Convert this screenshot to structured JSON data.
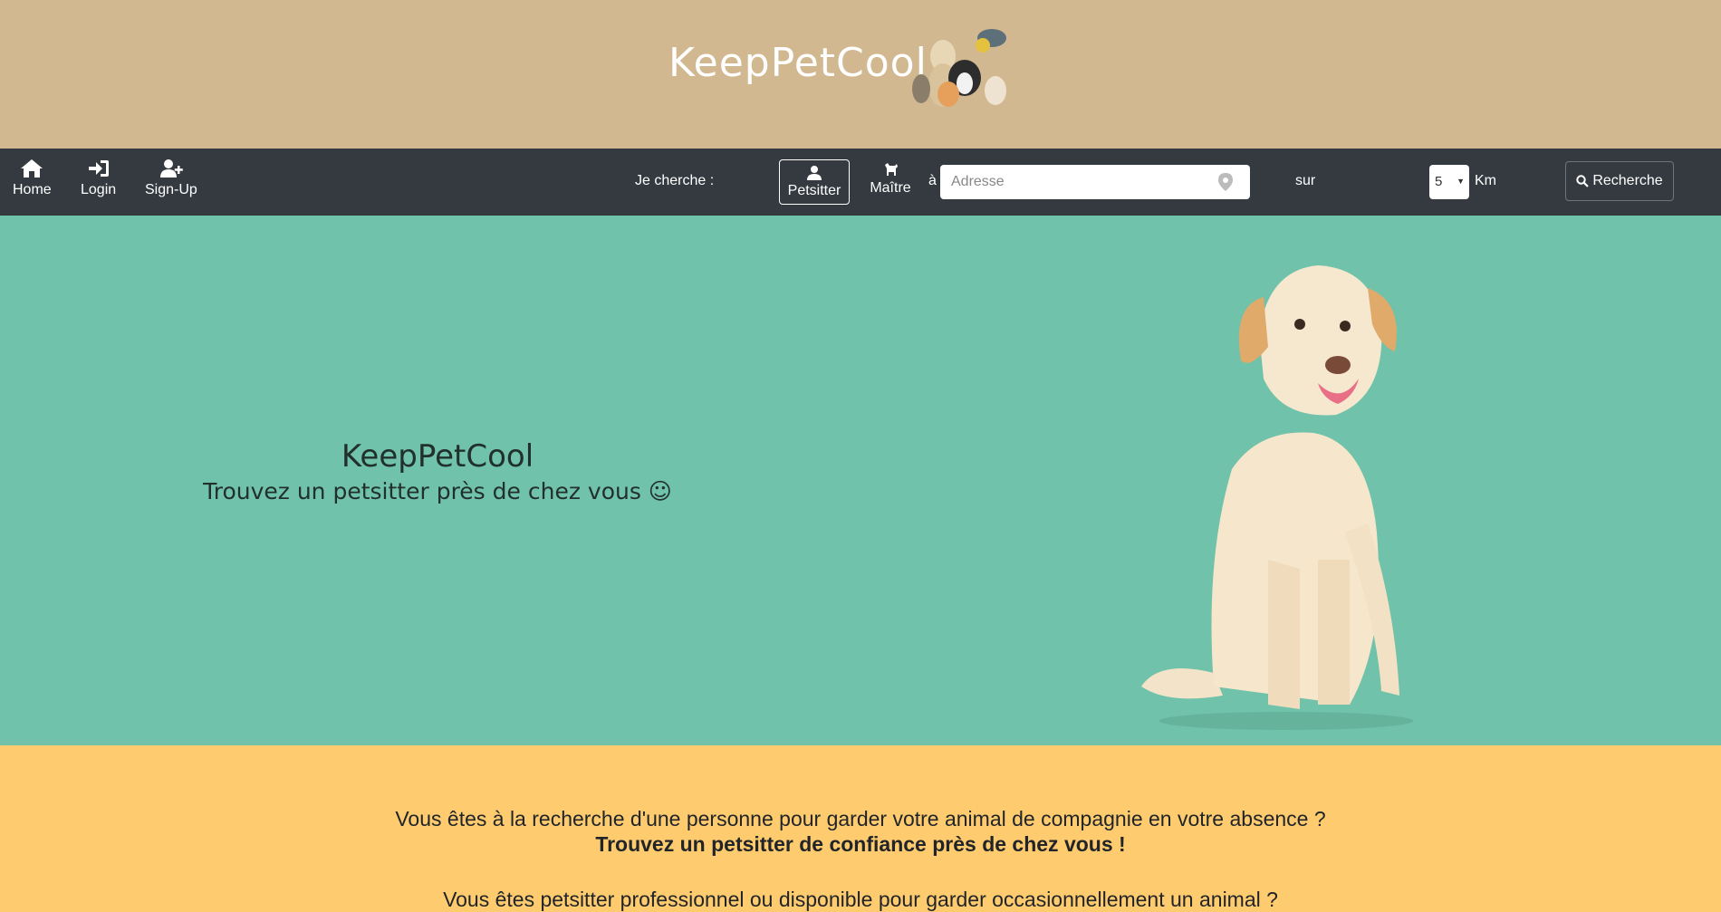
{
  "header": {
    "brand": "KeepPetCool",
    "image_alt": "pets-group"
  },
  "nav": {
    "home": "Home",
    "login": "Login",
    "signup": "Sign-Up"
  },
  "search": {
    "label": "Je cherche :",
    "petsitter": "Petsitter",
    "maitre": "Maître",
    "a": "à",
    "address_placeholder": "Adresse",
    "sur": "sur",
    "km_value": "5",
    "km_unit": "Km",
    "button": "Recherche"
  },
  "hero": {
    "title": "KeepPetCool",
    "subtitle": "Trouvez un petsitter près de chez vous ☺"
  },
  "info": {
    "line1": "Vous êtes à la recherche d'une personne pour garder votre animal de compagnie en votre absence ?",
    "line2": "Trouvez un petsitter de confiance près de chez vous !",
    "line3": "Vous êtes petsitter professionnel ou disponible pour garder occasionnellement un animal ?"
  },
  "colors": {
    "header_bg": "#d1b890",
    "navbar_bg": "#343a40",
    "hero_bg": "#70c2aa",
    "info_bg": "#fecb6e"
  }
}
